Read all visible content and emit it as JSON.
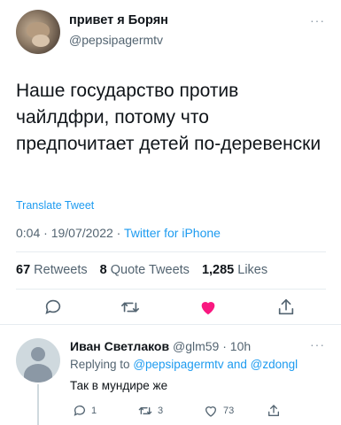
{
  "tweet": {
    "author_name": "привет я Борян",
    "author_handle": "@pepsipagermtv",
    "more_label": "···",
    "text": "Наше государство против чайлдфри, потому что предпочитает детей по-деревенски",
    "translate_label": "Translate Tweet",
    "time": "0:04",
    "date": "19/07/2022",
    "sep": "·",
    "source": "Twitter for iPhone",
    "stats": {
      "retweets_count": "67",
      "retweets_label": "Retweets",
      "quotes_count": "8",
      "quotes_label": "Quote Tweets",
      "likes_count": "1,285",
      "likes_label": "Likes"
    },
    "actions": {
      "reply_icon": "reply-icon",
      "retweet_icon": "retweet-icon",
      "like_icon": "heart-filled-icon",
      "share_icon": "share-icon",
      "like_color": "#f91880",
      "icon_color": "#536471"
    }
  },
  "reply": {
    "author_name": "Иван Светлаков",
    "author_handle": "@glm59",
    "sep": "·",
    "time": "10h",
    "more_label": "···",
    "replying_prefix": "Replying to",
    "mention_1": "@pepsipagermtv",
    "and": "and",
    "mention_2": "@zdongl",
    "text": "Так в мундире же",
    "actions": {
      "reply_count": "1",
      "retweet_count": "3",
      "like_count": "73"
    }
  },
  "colors": {
    "accent": "#1d9bf0",
    "secondary_text": "#536471",
    "divider": "#e6ecf0"
  }
}
